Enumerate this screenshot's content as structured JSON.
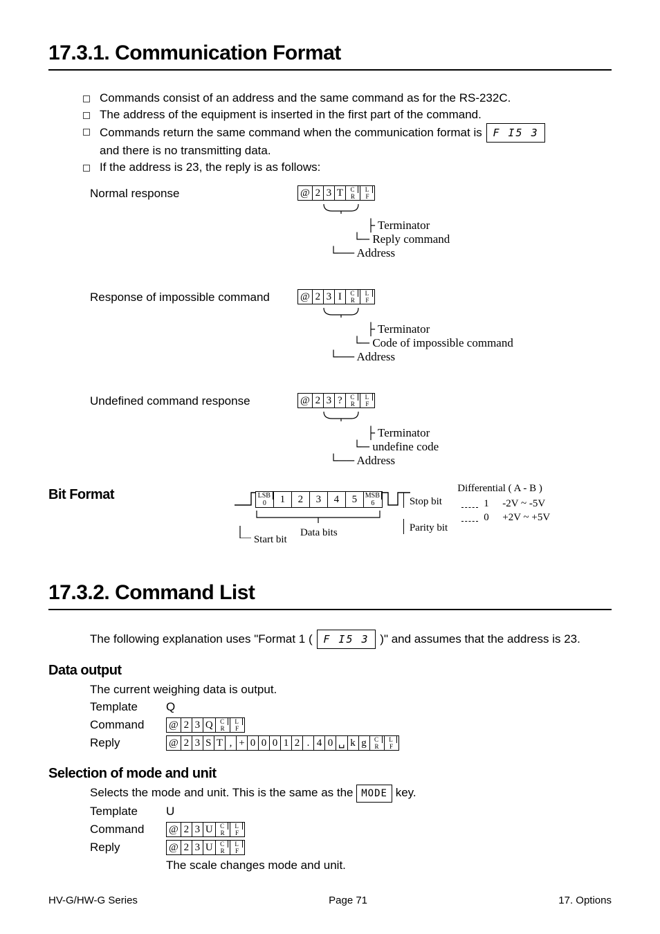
{
  "section1": {
    "title": "17.3.1. Communication Format",
    "bullets": [
      "Commands consist of an address and the same command as for the RS-232C.",
      "The address of the equipment is inserted in the first part of the command.",
      "Commands return the same command when the communication format is",
      "and there is no transmitting data.",
      "If the address is 23, the reply is as follows:"
    ],
    "segFormat": "F I5 3",
    "responses": {
      "normal": {
        "label": "Normal response",
        "bytes": [
          "@",
          "2",
          "3",
          "T"
        ],
        "callouts": [
          "Terminator",
          "Reply command",
          "Address"
        ]
      },
      "impossible": {
        "label": "Response of impossible command",
        "bytes": [
          "@",
          "2",
          "3",
          "I"
        ],
        "callouts": [
          "Terminator",
          "Code of impossible command",
          "Address"
        ]
      },
      "undefined": {
        "label": "Undefined command response",
        "bytes": [
          "@",
          "2",
          "3",
          "?"
        ],
        "callouts": [
          "Terminator",
          "undefine code",
          "Address"
        ]
      }
    },
    "bitFormat": {
      "title": "Bit Format",
      "bits": [
        "LSB 0",
        "1",
        "2",
        "3",
        "4",
        "5",
        "MSB 6"
      ],
      "annDataBits": "Data bits",
      "annStartBit": "Start bit",
      "annStopBit": "Stop bit",
      "annParityBit": "Parity bit",
      "levelsTitle": "Differential ( A - B )",
      "level1": "1",
      "level1Range": "-2V  ~  -5V",
      "level0": "0",
      "level0Range": "+2V ~  +5V"
    }
  },
  "section2": {
    "title": "17.3.2. Command List",
    "intro1": "The following explanation uses \"Format 1 (",
    "introSeg": "F I5 3",
    "intro2": ")\" and assumes that the address is 23.",
    "dataOutput": {
      "title": "Data output",
      "desc": "The current weighing data is output.",
      "templateLabel": "Template",
      "templateVal": "Q",
      "commandLabel": "Command",
      "commandBytes": [
        "@",
        "2",
        "3",
        "Q"
      ],
      "replyLabel": "Reply",
      "replyBytes": [
        "@",
        "2",
        "3",
        "S",
        "T",
        ",",
        "+",
        "0",
        "0",
        "0",
        "1",
        "2",
        ".",
        "4",
        "0",
        "␣",
        "k",
        "g"
      ]
    },
    "modeUnit": {
      "title": "Selection of mode and unit",
      "desc1": "Selects the mode and unit. This is the same as the",
      "key": "MODE",
      "desc2": "key.",
      "templateLabel": "Template",
      "templateVal": "U",
      "commandLabel": "Command",
      "commandBytes": [
        "@",
        "2",
        "3",
        "U"
      ],
      "replyLabel": "Reply",
      "replyBytes": [
        "@",
        "2",
        "3",
        "U"
      ],
      "replyNote": "The scale changes mode and unit."
    }
  },
  "footer": {
    "left": "HV-G/HW-G Series",
    "center": "Page 71",
    "right": "17. Options"
  }
}
